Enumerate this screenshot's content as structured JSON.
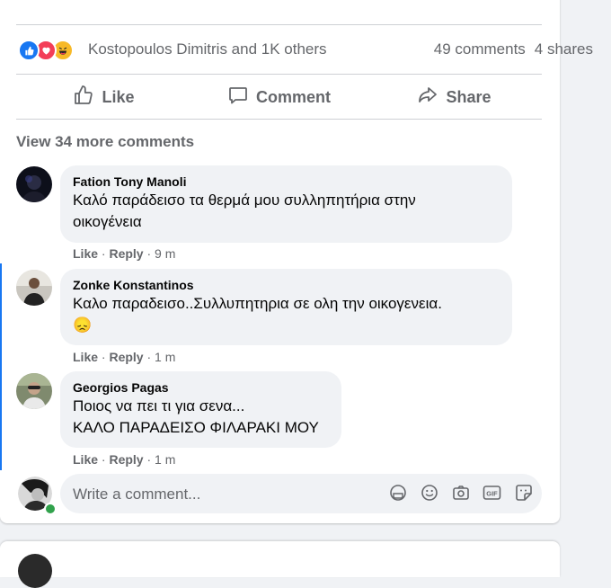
{
  "post": {
    "reactions": {
      "types": [
        "like-icon",
        "love-icon",
        "haha-icon"
      ],
      "summary": "Kostopoulos Dimitris and 1K others",
      "comments_count": "49 comments",
      "shares_count": "4 shares"
    },
    "actions": {
      "like": "Like",
      "comment": "Comment",
      "share": "Share"
    },
    "view_more": "View 34 more comments"
  },
  "comments": [
    {
      "author": "Fation Tony Manoli",
      "line1": "Καλό παράδεισο τα θερμά μου συλληπητήρια στην",
      "line2": "οικογένεια",
      "like": "Like",
      "reply": "Reply",
      "time": "9 m",
      "separator": "·"
    },
    {
      "author": "Zonke Konstantinos",
      "line1": "Καλο παραδεισο..Συλλυπητηρια σε ολη την οικογενεια.",
      "emoji": "😞",
      "like": "Like",
      "reply": "Reply",
      "time": "1 m",
      "separator": "·"
    },
    {
      "author": "Georgios Pagas",
      "line1": "Ποιος να πει τι για σενα...",
      "line2": "ΚΑΛΟ ΠΑΡΑΔΕΙΣΟ ΦΙΛΑΡΑΚΙ ΜΟΥ",
      "like": "Like",
      "reply": "Reply",
      "time": "1 m",
      "separator": "·"
    }
  ],
  "composer": {
    "placeholder": "Write a comment...",
    "icons": [
      "sticker-avatar-icon",
      "emoji-icon",
      "camera-icon",
      "gif-icon",
      "sticker-icon"
    ],
    "gif_label": "GIF"
  },
  "colors": {
    "accent": "#1877f2",
    "text_secondary": "#65676b",
    "bubble": "#f0f2f5",
    "online": "#31a24c"
  }
}
